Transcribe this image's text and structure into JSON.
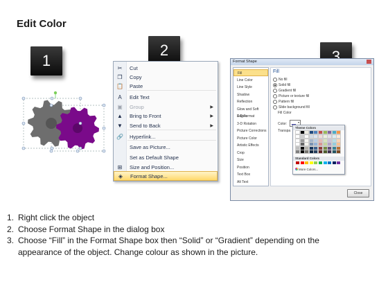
{
  "title": "Edit Color",
  "steps": {
    "one": "1",
    "two": "2",
    "three": "3"
  },
  "context_menu": {
    "items": [
      {
        "label": "Cut",
        "icon": "scissors-icon",
        "disabled": false,
        "submenu": false
      },
      {
        "label": "Copy",
        "icon": "copy-icon",
        "disabled": false,
        "submenu": false
      },
      {
        "label": "Paste",
        "icon": "paste-icon",
        "disabled": false,
        "submenu": false
      },
      {
        "label": "Edit Text",
        "icon": "edit-text-icon",
        "disabled": false,
        "submenu": false
      },
      {
        "label": "Group",
        "icon": "group-icon",
        "disabled": true,
        "submenu": true
      },
      {
        "label": "Bring to Front",
        "icon": "bring-front-icon",
        "disabled": false,
        "submenu": true
      },
      {
        "label": "Send to Back",
        "icon": "send-back-icon",
        "disabled": false,
        "submenu": true
      },
      {
        "label": "Hyperlink...",
        "icon": "hyperlink-icon",
        "disabled": false,
        "submenu": false
      },
      {
        "label": "Save as Picture...",
        "icon": "",
        "disabled": false,
        "submenu": false
      },
      {
        "label": "Set as Default Shape",
        "icon": "",
        "disabled": false,
        "submenu": false
      },
      {
        "label": "Size and Position...",
        "icon": "size-position-icon",
        "disabled": false,
        "submenu": false
      },
      {
        "label": "Format Shape...",
        "icon": "format-shape-icon",
        "disabled": false,
        "submenu": false,
        "highlighted": true
      }
    ]
  },
  "dialog": {
    "title": "Format Shape",
    "categories": [
      "Fill",
      "Line Color",
      "Line Style",
      "Shadow",
      "Reflection",
      "Glow and Soft Edges",
      "3-D Format",
      "3-D Rotation",
      "Picture Corrections",
      "Picture Color",
      "Artistic Effects",
      "Crop",
      "Size",
      "Position",
      "Text Box",
      "Alt Text"
    ],
    "selected_category": "Fill",
    "fill_heading": "Fill",
    "fill_options": [
      "No fill",
      "Solid fill",
      "Gradient fill",
      "Picture or texture fill",
      "Pattern fill",
      "Slide background fill"
    ],
    "fill_selected": "Solid fill",
    "fill_color_label": "Fill Color",
    "color_label": "Color:",
    "transparency_label": "Transpa",
    "close_label": "Close"
  },
  "color_picker": {
    "theme_header": "Theme Colors",
    "standard_header": "Standard Colors",
    "more_label": "More Colors...",
    "theme_top_row": [
      "#ffffff",
      "#000000",
      "#eeece1",
      "#1f497d",
      "#4f81bd",
      "#c0504d",
      "#9bbb59",
      "#8064a2",
      "#4bacc6",
      "#f79646"
    ],
    "standard_colors": [
      "#c00000",
      "#ff0000",
      "#ffc000",
      "#ffff00",
      "#92d050",
      "#00b050",
      "#00b0f0",
      "#0070c0",
      "#002060",
      "#7030a0"
    ]
  },
  "instructions": [
    {
      "num": "1.",
      "text": "Right click the object"
    },
    {
      "num": "2.",
      "text": "Choose Format Shape in the dialog box"
    },
    {
      "num": "3.",
      "text": "Choose “Fill” in the Format Shape box then “Solid” or “Gradient” depending on the appearance of the object. Change colour as shown in the picture."
    }
  ],
  "colors": {
    "gear_gray": "#6e6e6e",
    "gear_purple": "#7a0a8a",
    "highlight": "#ffd86b",
    "dialog_accent": "#1f4e90"
  }
}
